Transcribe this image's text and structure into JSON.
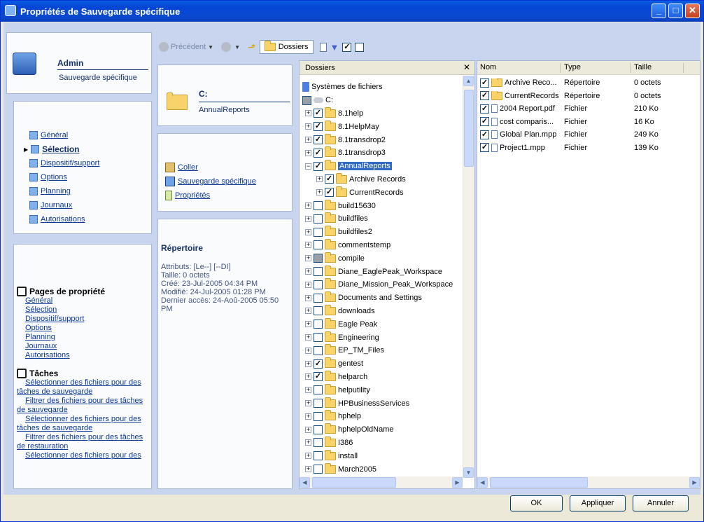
{
  "window": {
    "title": "Propriétés de Sauvegarde spécifique"
  },
  "header": {
    "user": "Admin",
    "subtitle": "Sauvegarde spécifique"
  },
  "nav": {
    "items": [
      "Général",
      "Sélection",
      "Dispositif/support",
      "Options",
      "Planning",
      "Journaux",
      "Autorisations"
    ],
    "active": "Sélection"
  },
  "props": {
    "heading": "Pages de propriété",
    "items": [
      "Général",
      "Sélection",
      "Dispositif/support",
      "Options",
      "Planning",
      "Journaux",
      "Autorisations"
    ],
    "tasks_heading": "Tâches",
    "tasks": [
      "Sélectionner des fichiers pour des tâches de sauvegarde",
      "Filtrer des fichiers pour des tâches de sauvegarde",
      "Sélectionner des fichiers pour des tâches de sauvegarde",
      "Filtrer des fichiers pour des tâches de restauration",
      "Sélectionner des fichiers pour des"
    ]
  },
  "drive": {
    "name": "C:",
    "path": "AnnualReports"
  },
  "actions": {
    "paste": "Coller",
    "backup": "Sauvegarde spécifique",
    "properties": "Propriétés"
  },
  "info": {
    "heading": "Répertoire",
    "attributes": "Attributs: [Le--] [--DI]",
    "size": "Taille: 0 octets",
    "created": "Créé: 23-Jul-2005 04:34 PM",
    "modified": "Modifié: 24-Jul-2005 01:28 PM",
    "accessed": "Dernier accès: 24-Aoû-2005 05:50 PM"
  },
  "toolbar": {
    "back": "Précédent",
    "folders": "Dossiers"
  },
  "tree": {
    "header": "Dossiers",
    "root": "Systèmes de fichiers",
    "drive": "C:",
    "rows": [
      {
        "label": "8.1help",
        "checked": "yes",
        "indent": 0
      },
      {
        "label": "8.1HelpMay",
        "checked": "yes",
        "indent": 0
      },
      {
        "label": "8.1transdrop2",
        "checked": "yes",
        "indent": 0
      },
      {
        "label": "8.1transdrop3",
        "checked": "yes",
        "indent": 0
      },
      {
        "label": "AnnualReports",
        "checked": "yes",
        "indent": 0,
        "selected": true,
        "expanded": true
      },
      {
        "label": "Archive Records",
        "checked": "yes",
        "indent": 1
      },
      {
        "label": "CurrentRecords",
        "checked": "yes",
        "indent": 1
      },
      {
        "label": "build15630",
        "checked": "no",
        "indent": 0
      },
      {
        "label": "buildfiles",
        "checked": "no",
        "indent": 0
      },
      {
        "label": "buildfiles2",
        "checked": "no",
        "indent": 0
      },
      {
        "label": "commentstemp",
        "checked": "no",
        "indent": 0
      },
      {
        "label": "compile",
        "checked": "partial",
        "indent": 0
      },
      {
        "label": "Diane_EaglePeak_Workspace",
        "checked": "no",
        "indent": 0
      },
      {
        "label": "Diane_Mission_Peak_Workspace",
        "checked": "no",
        "indent": 0
      },
      {
        "label": "Documents and Settings",
        "checked": "no",
        "indent": 0
      },
      {
        "label": "downloads",
        "checked": "no",
        "indent": 0
      },
      {
        "label": "Eagle Peak",
        "checked": "no",
        "indent": 0
      },
      {
        "label": "Engineering",
        "checked": "no",
        "indent": 0
      },
      {
        "label": "EP_TM_Files",
        "checked": "no",
        "indent": 0
      },
      {
        "label": "gentest",
        "checked": "yes",
        "indent": 0
      },
      {
        "label": "helparch",
        "checked": "yes",
        "indent": 0
      },
      {
        "label": "helputility",
        "checked": "no",
        "indent": 0
      },
      {
        "label": "HPBusinessServices",
        "checked": "no",
        "indent": 0
      },
      {
        "label": "hphelp",
        "checked": "no",
        "indent": 0
      },
      {
        "label": "hphelpOldName",
        "checked": "no",
        "indent": 0
      },
      {
        "label": "I386",
        "checked": "no",
        "indent": 0
      },
      {
        "label": "install",
        "checked": "no",
        "indent": 0
      },
      {
        "label": "March2005",
        "checked": "no",
        "indent": 0
      }
    ]
  },
  "files": {
    "columns": [
      "Nom",
      "Type",
      "Taille"
    ],
    "rows": [
      {
        "name": "Archive Reco...",
        "type": "Répertoire",
        "size": "0 octets",
        "kind": "folder"
      },
      {
        "name": "CurrentRecords",
        "type": "Répertoire",
        "size": "0 octets",
        "kind": "folder"
      },
      {
        "name": "2004 Report.pdf",
        "type": "Fichier",
        "size": "210 Ko",
        "kind": "file"
      },
      {
        "name": "cost comparis...",
        "type": "Fichier",
        "size": "16 Ko",
        "kind": "file"
      },
      {
        "name": "Global Plan.mpp",
        "type": "Fichier",
        "size": "249 Ko",
        "kind": "file"
      },
      {
        "name": "Project1.mpp",
        "type": "Fichier",
        "size": "139 Ko",
        "kind": "file"
      }
    ]
  },
  "buttons": {
    "ok": "OK",
    "apply": "Appliquer",
    "cancel": "Annuler"
  },
  "colors": {
    "title_bar": "#0a4ad0",
    "selection": "#316ac5",
    "link": "#0b3899"
  }
}
